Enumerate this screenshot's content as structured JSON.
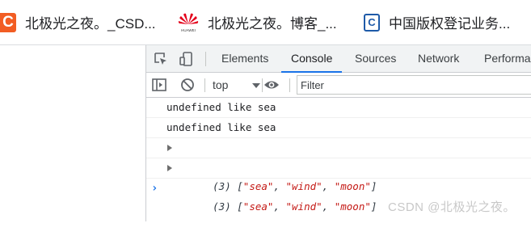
{
  "bookmarks": [
    {
      "label": "北极光之夜。_CSD...",
      "icon": "csdn-icon",
      "icon_text": "C"
    },
    {
      "label": "北极光之夜。博客_...",
      "icon": "huawei-icon",
      "icon_text": "HUAWEI"
    },
    {
      "label": "中国版权登记业务...",
      "icon": "cpcc-icon",
      "icon_text": "C"
    }
  ],
  "devtools": {
    "tabs": [
      {
        "label": "Elements"
      },
      {
        "label": "Console",
        "active": true
      },
      {
        "label": "Sources"
      },
      {
        "label": "Network"
      },
      {
        "label": "Performa"
      }
    ],
    "toolbar": {
      "level": "top",
      "filter_placeholder": "Filter"
    },
    "console": {
      "messages": [
        {
          "type": "log",
          "text": "undefined like sea"
        },
        {
          "type": "log",
          "text": "undefined like sea"
        },
        {
          "type": "object",
          "prefix": "(3) [",
          "items": [
            "\"sea\"",
            "\"wind\"",
            "\"moon\""
          ],
          "suffix": "]"
        },
        {
          "type": "object",
          "prefix": "(3) [",
          "items": [
            "\"sea\"",
            "\"wind\"",
            "\"moon\""
          ],
          "suffix": "]"
        }
      ],
      "prompt": "›"
    }
  },
  "watermark": "CSDN @北极光之夜。",
  "colors": {
    "accent": "#1a73e8",
    "string": "#c41a16",
    "csdn_brand": "#f25d23",
    "huawei_brand": "#e3001b"
  }
}
